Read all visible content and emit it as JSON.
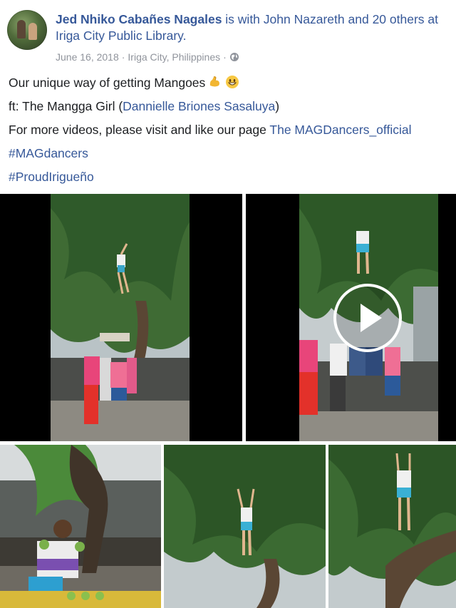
{
  "post": {
    "author": "Jed Nhiko Cabañes Nagales",
    "with_text": "is with",
    "tagged_person": "John Nazareth",
    "and_text": "and",
    "others": "20 others",
    "at_text": "at",
    "place": "Iriga City Public Library.",
    "date": "June 16, 2018",
    "location": "Iriga City, Philippines",
    "separator": "·",
    "line1": "Our unique way of getting Mangoes",
    "line2_prefix": "ft: The Mangga Girl (",
    "line2_link": "Dannielle Briones Sasaluya",
    "line2_suffix": ")",
    "line3_prefix": "For more videos, please visit and like our page ",
    "line3_link": "The MAGDancers_official",
    "hashtag1": "#MAGdancers",
    "hashtag2": "#ProudIrigueño"
  },
  "icons": {
    "globe": "globe-icon",
    "emoji1": "flexed-biceps-emoji",
    "emoji2": "grinning-face-emoji",
    "play": "play-icon"
  },
  "colors": {
    "link": "#365899",
    "text": "#1c1e21",
    "meta": "#90949c"
  }
}
